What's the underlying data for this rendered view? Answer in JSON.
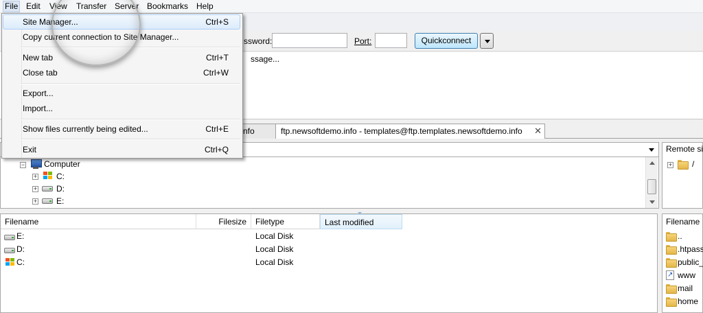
{
  "menubar": {
    "items": [
      "File",
      "Edit",
      "View",
      "Transfer",
      "Server",
      "Bookmarks",
      "Help"
    ]
  },
  "quickconnect": {
    "password_label": "ssword:",
    "port_label": "Port:",
    "button_label": "Quickconnect"
  },
  "log": {
    "line": "ssage..."
  },
  "tabs": [
    {
      "label": "nfo"
    },
    {
      "label": "ftp.newsoftdemo.info - templates@ftp.templates.newsoftdemo.info",
      "close": "✕"
    }
  ],
  "local_tree": {
    "root": "Computer",
    "drives": [
      "C:",
      "D:",
      "E:"
    ]
  },
  "local_list": {
    "columns": [
      "Filename",
      "Filesize",
      "Filetype",
      "Last modified"
    ],
    "rows": [
      {
        "name": "E:",
        "type": "Local Disk",
        "icon": "drive-icon"
      },
      {
        "name": "D:",
        "type": "Local Disk",
        "icon": "drive-icon"
      },
      {
        "name": "C:",
        "type": "Local Disk",
        "icon": "windows-drive-icon"
      }
    ]
  },
  "remote": {
    "site_label": "Remote si",
    "root": "/",
    "column": "Filename",
    "files": [
      "..",
      ".htpass",
      "public_",
      "www",
      "mail",
      "home"
    ]
  },
  "file_menu": {
    "items": [
      {
        "label": "Site Manager...",
        "shortcut": "Ctrl+S"
      },
      {
        "label": "Copy current connection to Site Manager...",
        "shortcut": ""
      },
      {
        "label": "New tab",
        "shortcut": "Ctrl+T"
      },
      {
        "label": "Close tab",
        "shortcut": "Ctrl+W"
      },
      {
        "label": "Export...",
        "shortcut": ""
      },
      {
        "label": "Import...",
        "shortcut": ""
      },
      {
        "label": "Show files currently being edited...",
        "shortcut": "Ctrl+E"
      },
      {
        "label": "Exit",
        "shortcut": "Ctrl+Q"
      }
    ]
  },
  "colors": {
    "menu_highlight": "#dcebfb",
    "button_accent": "#3c7fb1",
    "folder": "#e3b64a"
  }
}
